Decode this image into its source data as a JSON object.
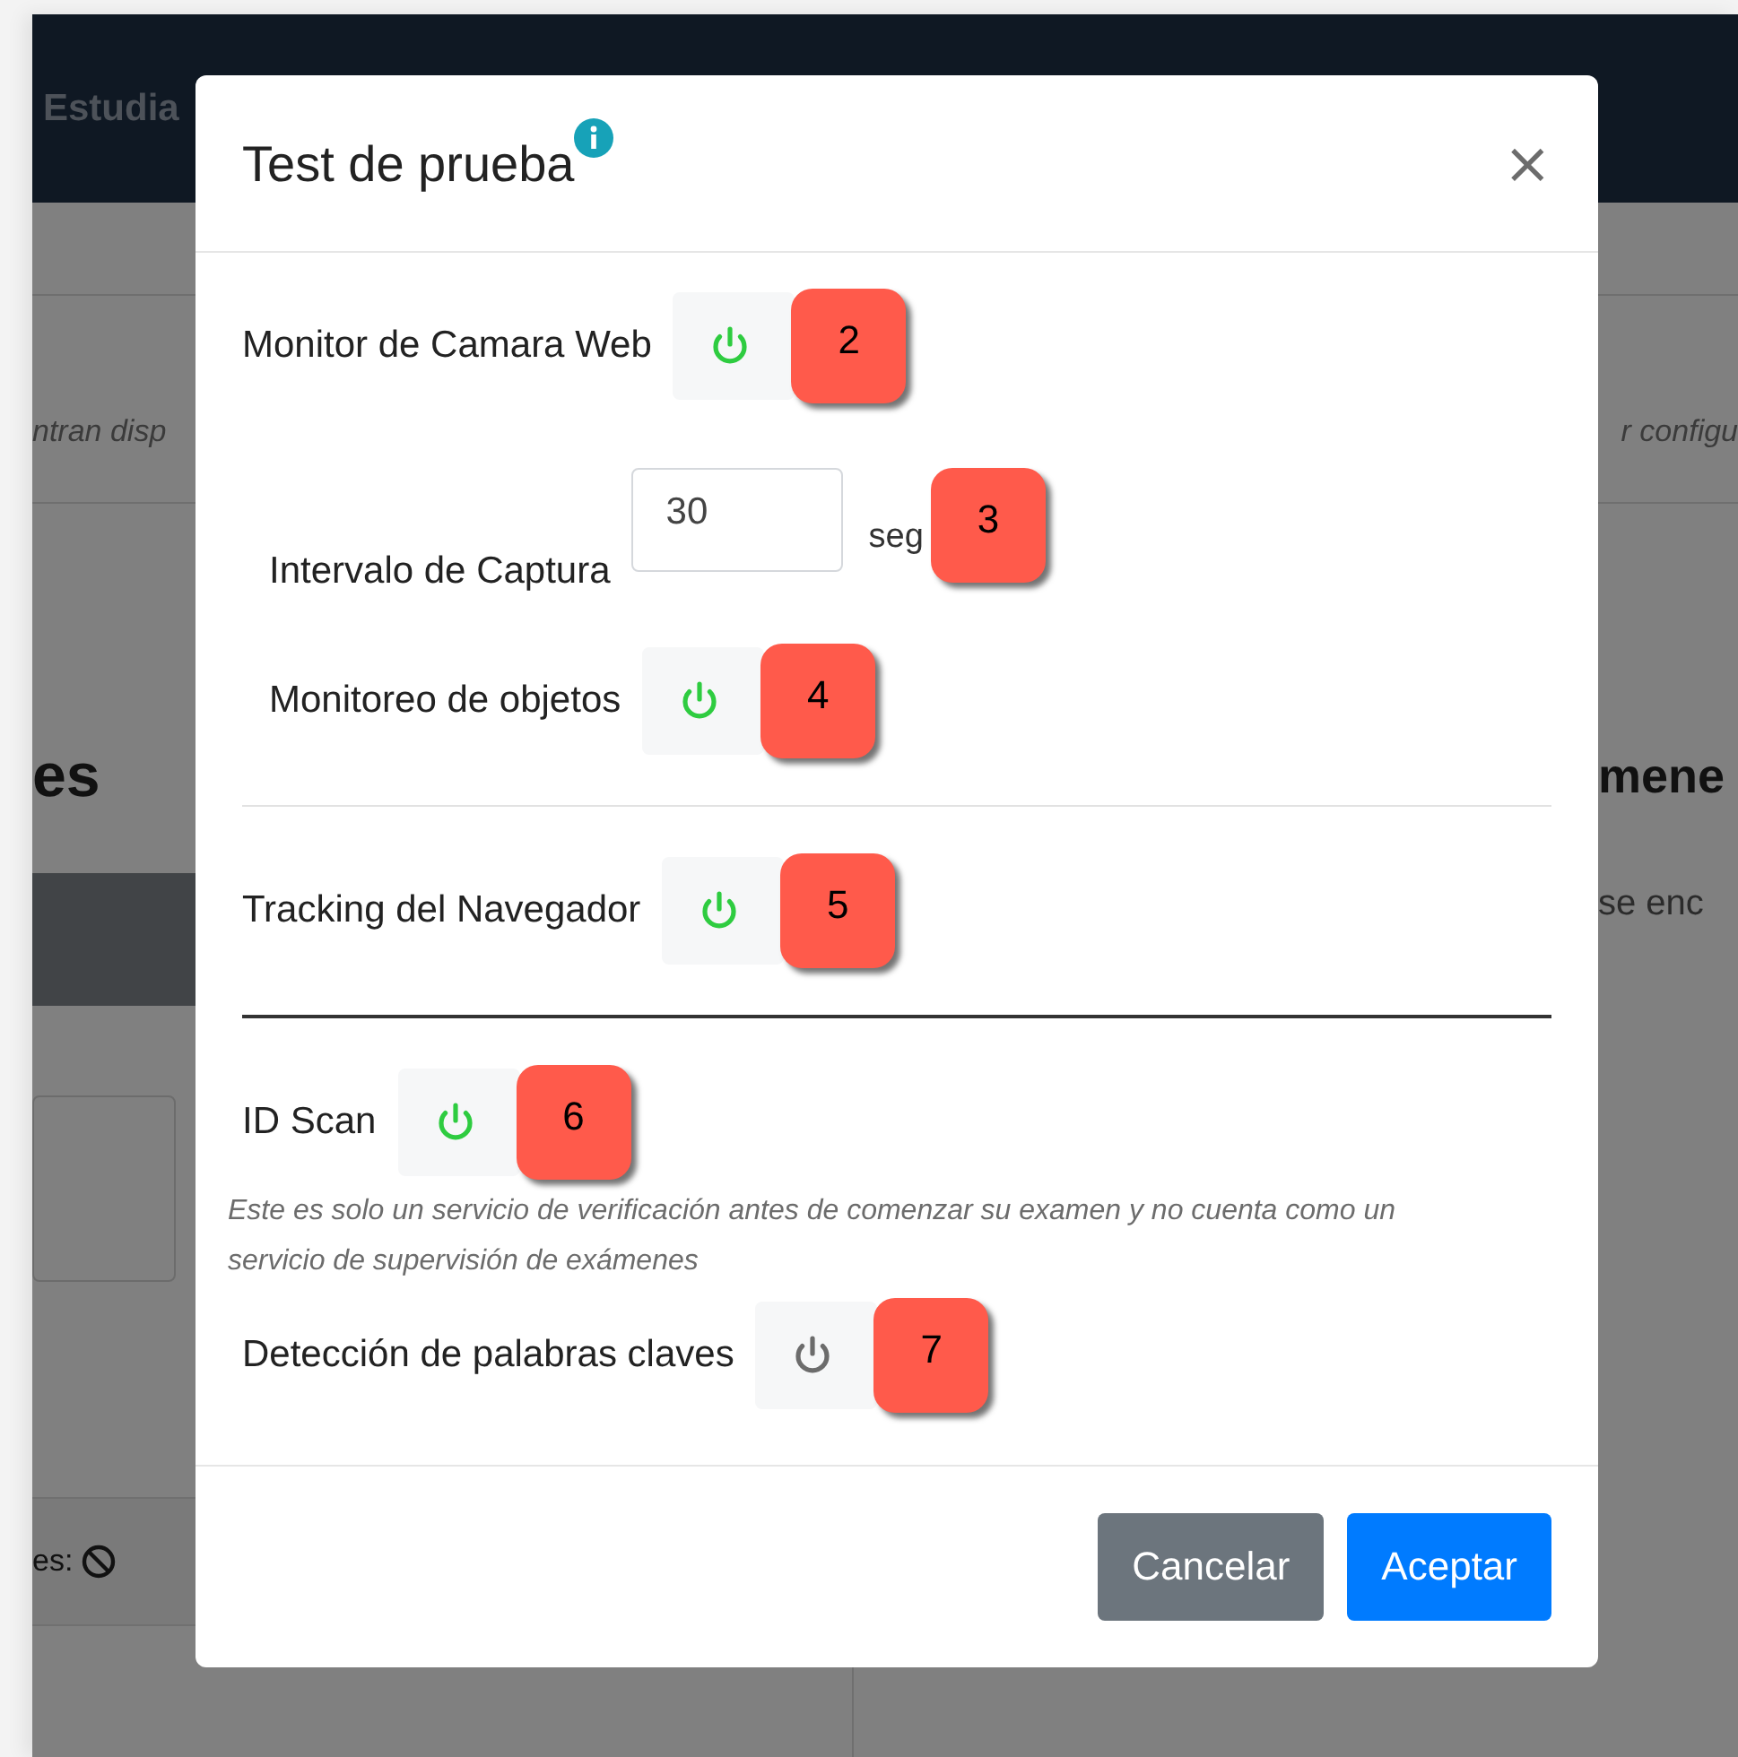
{
  "background": {
    "nav_title": "Estudia",
    "band_left": "ntran disp",
    "band_right": "r configu",
    "heading_left": "es",
    "heading_right": "mene",
    "text_right": "se enc",
    "footer_left": "es:"
  },
  "modal": {
    "title": "Test de prueba",
    "close": "×",
    "groups": [
      [
        {
          "kind": "toggle",
          "label": "Monitor de Camara Web",
          "on": true,
          "badge": "2",
          "indented": false
        },
        {
          "kind": "interval",
          "label": "Intervalo de Captura",
          "value": "30",
          "unit": "seg",
          "badge": "3",
          "indented": true
        },
        {
          "kind": "toggle",
          "label": "Monitoreo de objetos",
          "on": true,
          "badge": "4",
          "indented": true
        }
      ],
      [
        {
          "kind": "toggle",
          "label": "Tracking del Navegador",
          "on": true,
          "badge": "5",
          "indented": false
        }
      ],
      [
        {
          "kind": "toggle",
          "label": "ID Scan",
          "on": true,
          "badge": "6",
          "indented": false,
          "note": "Este es solo un servicio de verificación antes de comenzar su examen y no cuenta como un servicio de supervisión de exámenes"
        },
        {
          "kind": "toggle",
          "label": "Detección de palabras claves",
          "on": false,
          "badge": "7",
          "indented": false
        }
      ]
    ],
    "buttons": [
      {
        "label": "Cancelar",
        "kind": "secondary"
      },
      {
        "label": "Aceptar",
        "kind": "primary"
      }
    ]
  }
}
